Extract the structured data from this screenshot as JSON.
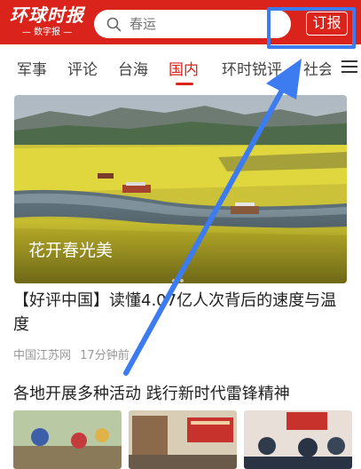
{
  "header": {
    "logo_main": "环球时报",
    "logo_sub": "— 数字报 —",
    "search_placeholder": "春运",
    "subscribe_label": "订报"
  },
  "nav": {
    "tabs": [
      "军事",
      "评论",
      "台海",
      "国内",
      "环时锐评",
      "社会"
    ],
    "active_tab": "国内"
  },
  "hero": {
    "caption": "花开春光美"
  },
  "articles": [
    {
      "title": "【好评中国】读懂4.07亿人次背后的速度与温度",
      "source": "中国江苏网",
      "time": "17分钟前"
    },
    {
      "title": "各地开展多种活动 践行新时代雷锋精神"
    }
  ],
  "colors": {
    "brand_red": "#d9231b",
    "annotation_blue": "#3c7bf0"
  },
  "icons": {
    "search": "search-icon",
    "menu": "menu-icon"
  }
}
